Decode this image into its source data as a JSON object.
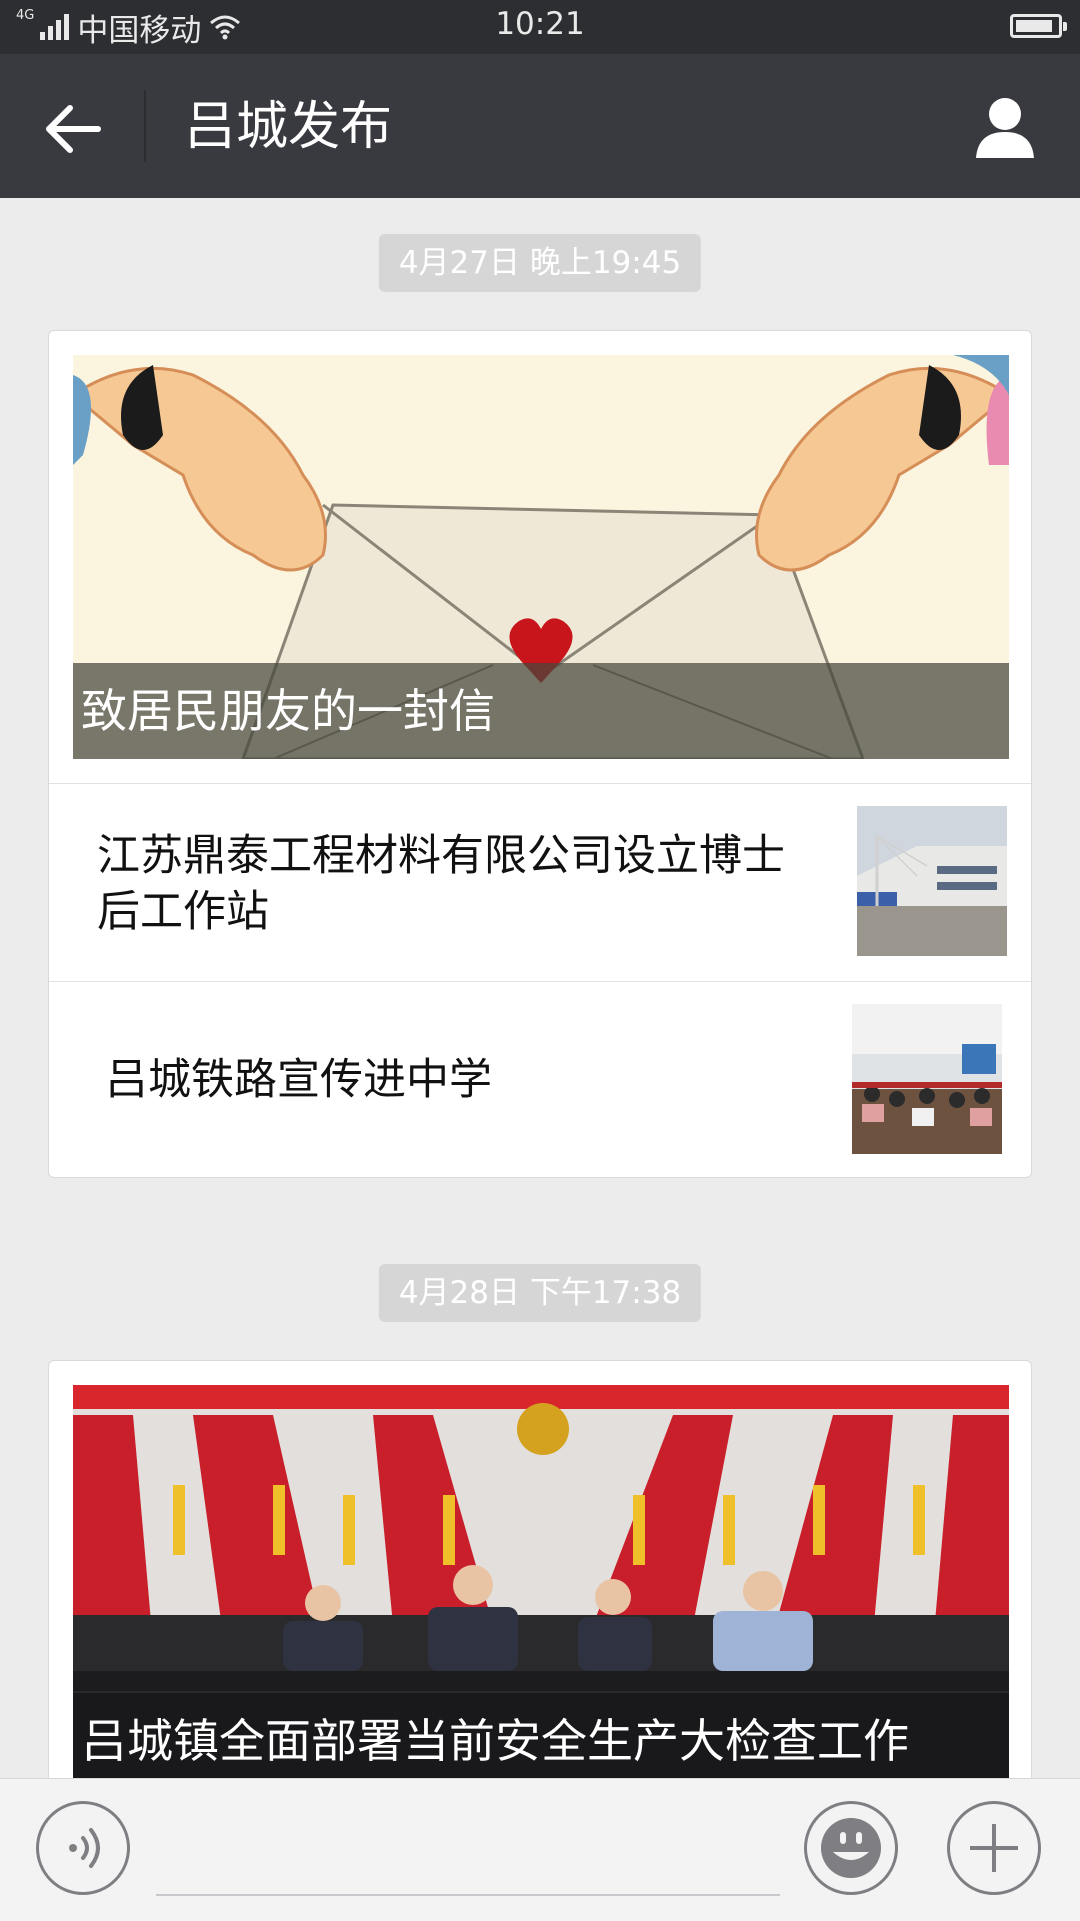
{
  "status_bar": {
    "network": "4G",
    "carrier": "中国移动",
    "time": "10:21",
    "battery_level": 0.9
  },
  "nav": {
    "title": "吕城发布",
    "back_icon": "arrow-left-icon",
    "profile_icon": "person-icon"
  },
  "messages": [
    {
      "timestamp": "4月27日 晚上19:45",
      "cover": {
        "title": "致居民朋友的一封信",
        "image": "envelope-illustration"
      },
      "items": [
        {
          "title": "江苏鼎泰工程材料有限公司设立博士后工作站",
          "image": "factory-building-photo"
        },
        {
          "title": "吕城铁路宣传进中学",
          "image": "classroom-photo"
        }
      ]
    },
    {
      "timestamp": "4月28日 下午17:38",
      "cover": {
        "title": "吕城镇全面部署当前安全生产大检查工作",
        "image": "meeting-stage-photo"
      }
    }
  ],
  "input_bar": {
    "voice_icon": "voice-icon",
    "emoji_icon": "emoji-icon",
    "plus_icon": "plus-icon"
  },
  "colors": {
    "nav_bg": "#393a3f",
    "status_bg": "#2d2e31",
    "page_bg": "#ececec",
    "timestamp_bg": "#d6d6d6"
  }
}
